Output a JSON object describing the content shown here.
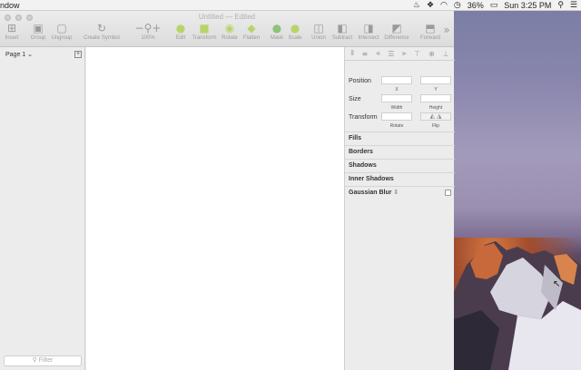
{
  "menubar": {
    "app_menu": "ndow",
    "battery": "36%",
    "clock": "Sun 3:25 PM",
    "status_icons": [
      "flame-icon",
      "dropbox-icon",
      "wifi-icon",
      "time-machine-icon",
      "battery-icon",
      "search-icon",
      "list-icon"
    ]
  },
  "window": {
    "title": "Untitled — Edited"
  },
  "toolbar": {
    "insert": "Insert",
    "group": "Group",
    "ungroup": "Ungroup",
    "create_symbol": "Create Symbol",
    "zoom": "100%",
    "edit": "Edit",
    "transform": "Transform",
    "rotate": "Rotate",
    "flatten": "Flatten",
    "mask": "Mask",
    "scale": "Scale",
    "union": "Union",
    "subtract": "Subtract",
    "intersect": "Intersect",
    "difference": "Difference",
    "forward": "Forward"
  },
  "sidebar": {
    "page": "Page 1",
    "filter_placeholder": "Filter"
  },
  "inspector": {
    "position": "Position",
    "x": "X",
    "y": "Y",
    "size": "Size",
    "width": "Width",
    "height": "Height",
    "transform": "Transform",
    "rotate": "Rotate",
    "flip": "Flip",
    "fills": "Fills",
    "borders": "Borders",
    "shadows": "Shadows",
    "inner_shadows": "Inner Shadows",
    "gaussian_blur": "Gaussian Blur"
  }
}
